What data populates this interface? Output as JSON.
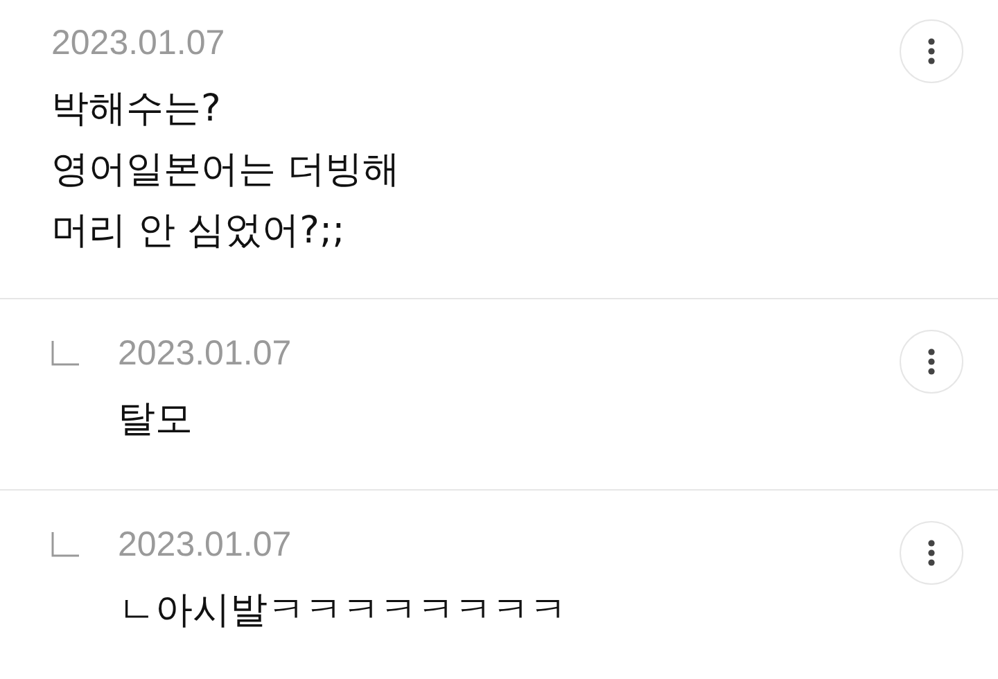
{
  "comments": [
    {
      "kind": "comment",
      "date": "2023.01.07",
      "text": "박해수는?\n영어일본어는 더빙해\n머리 안 심었어?;;"
    },
    {
      "kind": "reply",
      "date": "2023.01.07",
      "text": "탈모"
    },
    {
      "kind": "reply",
      "date": "2023.01.07",
      "text": "ㄴ아시발ㅋㅋㅋㅋㅋㅋㅋㅋ"
    }
  ]
}
